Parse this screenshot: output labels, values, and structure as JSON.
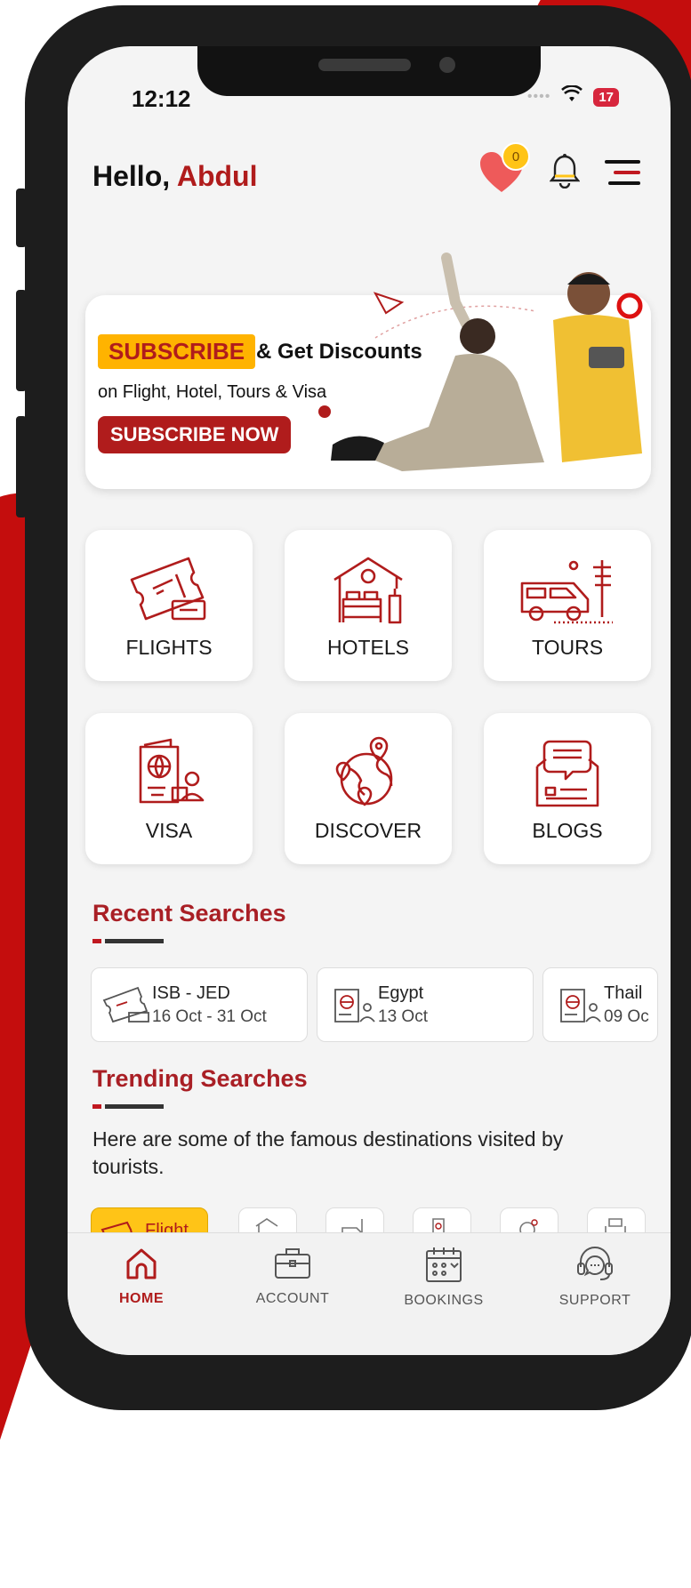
{
  "status_bar": {
    "time": "12:12",
    "battery": "17"
  },
  "header": {
    "greeting": "Hello,",
    "user_name": "Abdul",
    "wishlist_count": "0"
  },
  "banner": {
    "tag": "SUBSCRIBE",
    "headline_rest": "& Get Discounts",
    "subline": "on Flight, Hotel, Tours & Visa",
    "button": "SUBSCRIBE NOW"
  },
  "services": [
    {
      "label": "FLIGHTS",
      "icon": "flight-ticket-icon"
    },
    {
      "label": "HOTELS",
      "icon": "hotel-bed-icon"
    },
    {
      "label": "TOURS",
      "icon": "tour-van-icon"
    },
    {
      "label": "VISA",
      "icon": "passport-icon"
    },
    {
      "label": "DISCOVER",
      "icon": "globe-pin-icon"
    },
    {
      "label": "BLOGS",
      "icon": "blog-chat-icon"
    }
  ],
  "recent": {
    "title": "Recent Searches",
    "items": [
      {
        "line1": "ISB - JED",
        "line2": "16 Oct - 31 Oct",
        "icon": "flight-ticket-icon"
      },
      {
        "line1": "Egypt",
        "line2": "13 Oct",
        "icon": "passport-icon"
      },
      {
        "line1": "Thail",
        "line2": "09 Oc",
        "icon": "passport-icon"
      }
    ]
  },
  "trending": {
    "title": "Trending Searches",
    "description": "Here are some of the famous destinations visited by tourists.",
    "active_chip": "Flight"
  },
  "bottom_nav": [
    {
      "label": "HOME",
      "icon": "home-icon",
      "active": true
    },
    {
      "label": "ACCOUNT",
      "icon": "briefcase-icon",
      "active": false
    },
    {
      "label": "BOOKINGS",
      "icon": "calendar-icon",
      "active": false
    },
    {
      "label": "SUPPORT",
      "icon": "headset-icon",
      "active": false
    }
  ],
  "colors": {
    "brand_red": "#b01c1c",
    "accent_yellow": "#ffc417",
    "heart": "#ee5a5a"
  }
}
